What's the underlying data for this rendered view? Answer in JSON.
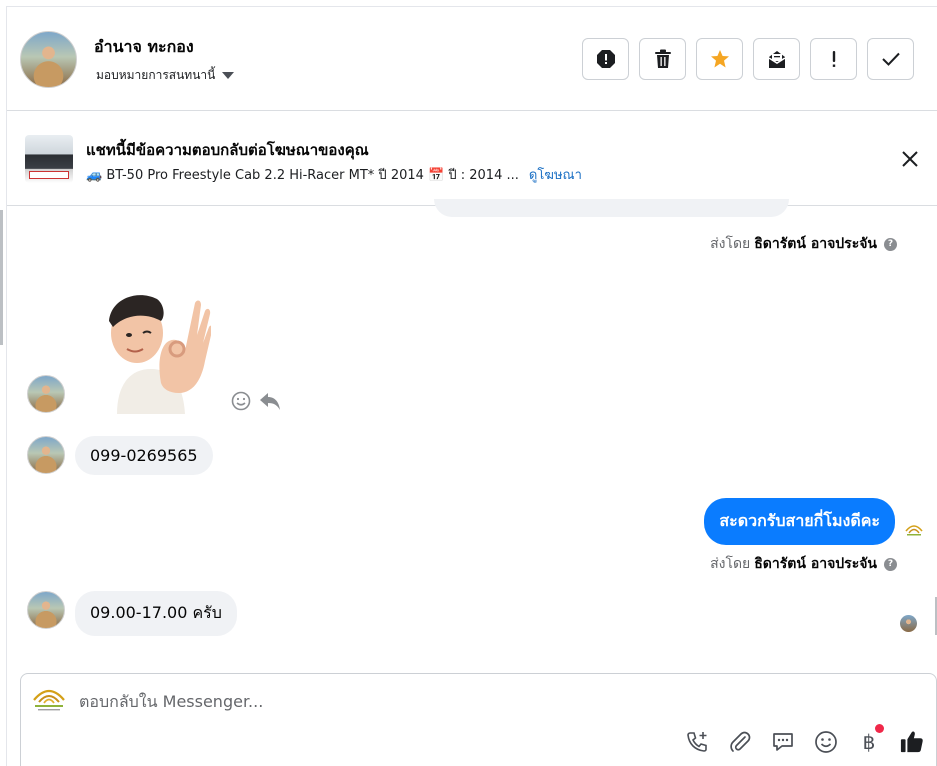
{
  "header": {
    "contact_name": "อำนาจ ทะกอง",
    "assign_label": "มอบหมายการสนทนานี้",
    "toolbar": [
      {
        "icon": "spam-alert-icon"
      },
      {
        "icon": "trash-icon"
      },
      {
        "icon": "star-icon",
        "color": "#f5a623"
      },
      {
        "icon": "mark-unread-icon"
      },
      {
        "icon": "exclamation-icon"
      },
      {
        "icon": "checkmark-icon"
      }
    ]
  },
  "ad_banner": {
    "title": "แชทนี้มีข้อความตอบกลับต่อโฆษณาของคุณ",
    "subtitle": "🚙 BT-50 Pro Freestyle Cab 2.2 Hi-Racer MT* ปี 2014 📅 ปี : 2014 ...",
    "link_label": "ดูโฆษณา"
  },
  "conversation": {
    "sent_by_prefix": "ส่งโดย",
    "sent_by_name": "ธิดารัตน์ อาจประจัน",
    "help_mark": "?",
    "messages": [
      {
        "direction": "in",
        "text": "099-0269565"
      },
      {
        "direction": "out",
        "text": "สะดวกรับสายกี่โมงดีคะ"
      },
      {
        "direction": "in",
        "text": "09.00-17.00 ครับ"
      }
    ]
  },
  "composer": {
    "placeholder": "ตอบกลับใน Messenger...",
    "baht_symbol": "฿",
    "tools": [
      "add-call-icon",
      "attach-icon",
      "saved-reply-icon",
      "emoji-icon",
      "payment-icon",
      "like-icon"
    ]
  },
  "colors": {
    "accent_blue": "#0a7cff",
    "incoming_bubble": "#f0f2f5",
    "link": "#1a6fc4",
    "notification_dot": "#f02849"
  }
}
